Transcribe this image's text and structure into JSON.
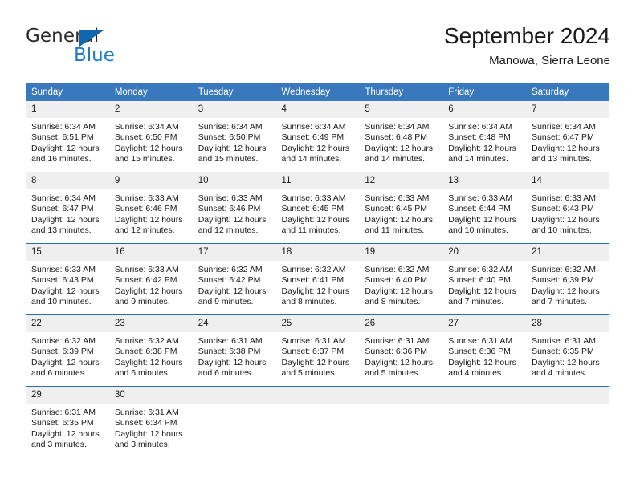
{
  "brand": {
    "name_part1": "General",
    "name_part2": "Blue",
    "triangle_color": "#1166b0",
    "blue_text_color": "#1f7ac4"
  },
  "header": {
    "title": "September 2024",
    "subtitle": "Manowa, Sierra Leone"
  },
  "theme": {
    "header_bg": "#3a78bd",
    "header_text": "#ffffff",
    "row_separator": "#2e6da4",
    "daynum_bg": "#efefef",
    "body_text": "#1a1a1a"
  },
  "columns": [
    "Sunday",
    "Monday",
    "Tuesday",
    "Wednesday",
    "Thursday",
    "Friday",
    "Saturday"
  ],
  "weeks": [
    [
      {
        "day": "1",
        "sunrise": "Sunrise: 6:34 AM",
        "sunset": "Sunset: 6:51 PM",
        "daylight_line1": "Daylight: 12 hours",
        "daylight_line2": "and 16 minutes."
      },
      {
        "day": "2",
        "sunrise": "Sunrise: 6:34 AM",
        "sunset": "Sunset: 6:50 PM",
        "daylight_line1": "Daylight: 12 hours",
        "daylight_line2": "and 15 minutes."
      },
      {
        "day": "3",
        "sunrise": "Sunrise: 6:34 AM",
        "sunset": "Sunset: 6:50 PM",
        "daylight_line1": "Daylight: 12 hours",
        "daylight_line2": "and 15 minutes."
      },
      {
        "day": "4",
        "sunrise": "Sunrise: 6:34 AM",
        "sunset": "Sunset: 6:49 PM",
        "daylight_line1": "Daylight: 12 hours",
        "daylight_line2": "and 14 minutes."
      },
      {
        "day": "5",
        "sunrise": "Sunrise: 6:34 AM",
        "sunset": "Sunset: 6:48 PM",
        "daylight_line1": "Daylight: 12 hours",
        "daylight_line2": "and 14 minutes."
      },
      {
        "day": "6",
        "sunrise": "Sunrise: 6:34 AM",
        "sunset": "Sunset: 6:48 PM",
        "daylight_line1": "Daylight: 12 hours",
        "daylight_line2": "and 14 minutes."
      },
      {
        "day": "7",
        "sunrise": "Sunrise: 6:34 AM",
        "sunset": "Sunset: 6:47 PM",
        "daylight_line1": "Daylight: 12 hours",
        "daylight_line2": "and 13 minutes."
      }
    ],
    [
      {
        "day": "8",
        "sunrise": "Sunrise: 6:34 AM",
        "sunset": "Sunset: 6:47 PM",
        "daylight_line1": "Daylight: 12 hours",
        "daylight_line2": "and 13 minutes."
      },
      {
        "day": "9",
        "sunrise": "Sunrise: 6:33 AM",
        "sunset": "Sunset: 6:46 PM",
        "daylight_line1": "Daylight: 12 hours",
        "daylight_line2": "and 12 minutes."
      },
      {
        "day": "10",
        "sunrise": "Sunrise: 6:33 AM",
        "sunset": "Sunset: 6:46 PM",
        "daylight_line1": "Daylight: 12 hours",
        "daylight_line2": "and 12 minutes."
      },
      {
        "day": "11",
        "sunrise": "Sunrise: 6:33 AM",
        "sunset": "Sunset: 6:45 PM",
        "daylight_line1": "Daylight: 12 hours",
        "daylight_line2": "and 11 minutes."
      },
      {
        "day": "12",
        "sunrise": "Sunrise: 6:33 AM",
        "sunset": "Sunset: 6:45 PM",
        "daylight_line1": "Daylight: 12 hours",
        "daylight_line2": "and 11 minutes."
      },
      {
        "day": "13",
        "sunrise": "Sunrise: 6:33 AM",
        "sunset": "Sunset: 6:44 PM",
        "daylight_line1": "Daylight: 12 hours",
        "daylight_line2": "and 10 minutes."
      },
      {
        "day": "14",
        "sunrise": "Sunrise: 6:33 AM",
        "sunset": "Sunset: 6:43 PM",
        "daylight_line1": "Daylight: 12 hours",
        "daylight_line2": "and 10 minutes."
      }
    ],
    [
      {
        "day": "15",
        "sunrise": "Sunrise: 6:33 AM",
        "sunset": "Sunset: 6:43 PM",
        "daylight_line1": "Daylight: 12 hours",
        "daylight_line2": "and 10 minutes."
      },
      {
        "day": "16",
        "sunrise": "Sunrise: 6:33 AM",
        "sunset": "Sunset: 6:42 PM",
        "daylight_line1": "Daylight: 12 hours",
        "daylight_line2": "and 9 minutes."
      },
      {
        "day": "17",
        "sunrise": "Sunrise: 6:32 AM",
        "sunset": "Sunset: 6:42 PM",
        "daylight_line1": "Daylight: 12 hours",
        "daylight_line2": "and 9 minutes."
      },
      {
        "day": "18",
        "sunrise": "Sunrise: 6:32 AM",
        "sunset": "Sunset: 6:41 PM",
        "daylight_line1": "Daylight: 12 hours",
        "daylight_line2": "and 8 minutes."
      },
      {
        "day": "19",
        "sunrise": "Sunrise: 6:32 AM",
        "sunset": "Sunset: 6:40 PM",
        "daylight_line1": "Daylight: 12 hours",
        "daylight_line2": "and 8 minutes."
      },
      {
        "day": "20",
        "sunrise": "Sunrise: 6:32 AM",
        "sunset": "Sunset: 6:40 PM",
        "daylight_line1": "Daylight: 12 hours",
        "daylight_line2": "and 7 minutes."
      },
      {
        "day": "21",
        "sunrise": "Sunrise: 6:32 AM",
        "sunset": "Sunset: 6:39 PM",
        "daylight_line1": "Daylight: 12 hours",
        "daylight_line2": "and 7 minutes."
      }
    ],
    [
      {
        "day": "22",
        "sunrise": "Sunrise: 6:32 AM",
        "sunset": "Sunset: 6:39 PM",
        "daylight_line1": "Daylight: 12 hours",
        "daylight_line2": "and 6 minutes."
      },
      {
        "day": "23",
        "sunrise": "Sunrise: 6:32 AM",
        "sunset": "Sunset: 6:38 PM",
        "daylight_line1": "Daylight: 12 hours",
        "daylight_line2": "and 6 minutes."
      },
      {
        "day": "24",
        "sunrise": "Sunrise: 6:31 AM",
        "sunset": "Sunset: 6:38 PM",
        "daylight_line1": "Daylight: 12 hours",
        "daylight_line2": "and 6 minutes."
      },
      {
        "day": "25",
        "sunrise": "Sunrise: 6:31 AM",
        "sunset": "Sunset: 6:37 PM",
        "daylight_line1": "Daylight: 12 hours",
        "daylight_line2": "and 5 minutes."
      },
      {
        "day": "26",
        "sunrise": "Sunrise: 6:31 AM",
        "sunset": "Sunset: 6:36 PM",
        "daylight_line1": "Daylight: 12 hours",
        "daylight_line2": "and 5 minutes."
      },
      {
        "day": "27",
        "sunrise": "Sunrise: 6:31 AM",
        "sunset": "Sunset: 6:36 PM",
        "daylight_line1": "Daylight: 12 hours",
        "daylight_line2": "and 4 minutes."
      },
      {
        "day": "28",
        "sunrise": "Sunrise: 6:31 AM",
        "sunset": "Sunset: 6:35 PM",
        "daylight_line1": "Daylight: 12 hours",
        "daylight_line2": "and 4 minutes."
      }
    ],
    [
      {
        "day": "29",
        "sunrise": "Sunrise: 6:31 AM",
        "sunset": "Sunset: 6:35 PM",
        "daylight_line1": "Daylight: 12 hours",
        "daylight_line2": "and 3 minutes."
      },
      {
        "day": "30",
        "sunrise": "Sunrise: 6:31 AM",
        "sunset": "Sunset: 6:34 PM",
        "daylight_line1": "Daylight: 12 hours",
        "daylight_line2": "and 3 minutes."
      },
      {
        "day": "",
        "sunrise": "",
        "sunset": "",
        "daylight_line1": "",
        "daylight_line2": ""
      },
      {
        "day": "",
        "sunrise": "",
        "sunset": "",
        "daylight_line1": "",
        "daylight_line2": ""
      },
      {
        "day": "",
        "sunrise": "",
        "sunset": "",
        "daylight_line1": "",
        "daylight_line2": ""
      },
      {
        "day": "",
        "sunrise": "",
        "sunset": "",
        "daylight_line1": "",
        "daylight_line2": ""
      },
      {
        "day": "",
        "sunrise": "",
        "sunset": "",
        "daylight_line1": "",
        "daylight_line2": ""
      }
    ]
  ]
}
